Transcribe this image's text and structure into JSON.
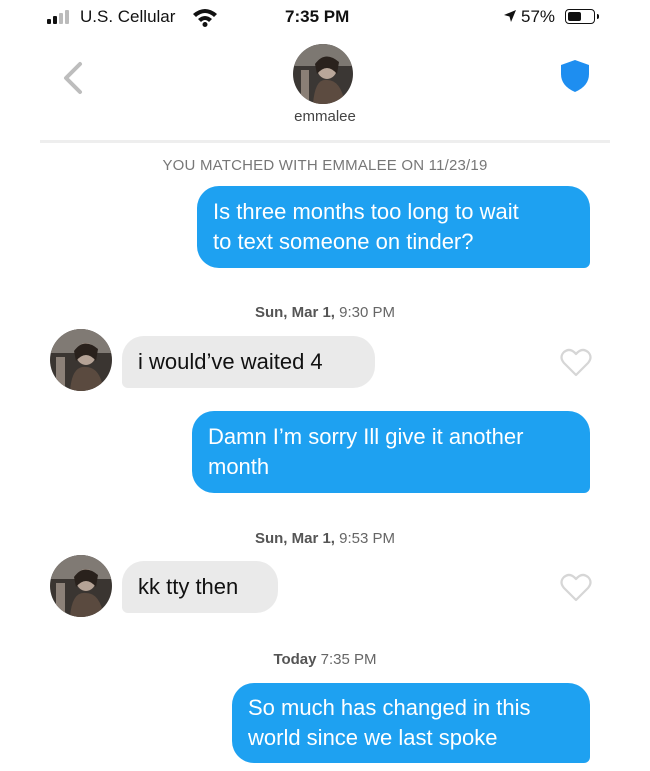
{
  "status_bar": {
    "carrier": "U.S. Cellular",
    "time": "7:35 PM",
    "battery": "57%",
    "battery_level": 0.57,
    "signal_bars": 2,
    "icons": [
      "signal-icon",
      "wifi-icon",
      "location-arrow-icon",
      "battery-icon"
    ]
  },
  "header": {
    "name": "emmalee",
    "icons": [
      "back-chevron-icon",
      "avatar",
      "shield-icon"
    ],
    "accent_color": "#1e8ef0"
  },
  "match_banner": "YOU MATCHED WITH EMMALEE ON 11/23/19",
  "messages": [
    {
      "type": "sent",
      "text_lines": [
        "Is three months too long to wait",
        "to text someone on tinder?"
      ]
    },
    {
      "type": "timestamp",
      "day": "Sun, Mar 1,",
      "time": "9:30 PM"
    },
    {
      "type": "received",
      "text": "i would’ve waited 4"
    },
    {
      "type": "sent",
      "text_lines": [
        "Damn I’m sorry Ill give it another",
        "month"
      ]
    },
    {
      "type": "timestamp",
      "day": "Sun, Mar 1,",
      "time": "9:53 PM"
    },
    {
      "type": "received",
      "text": "kk tty then"
    },
    {
      "type": "timestamp",
      "day": "Today",
      "time": "7:35 PM"
    },
    {
      "type": "sent",
      "text_lines": [
        "So much has changed in this",
        "world since we last spoke"
      ]
    }
  ],
  "colors": {
    "sent_bubble": "#1ea1f1",
    "received_bubble": "#eaeaea"
  }
}
